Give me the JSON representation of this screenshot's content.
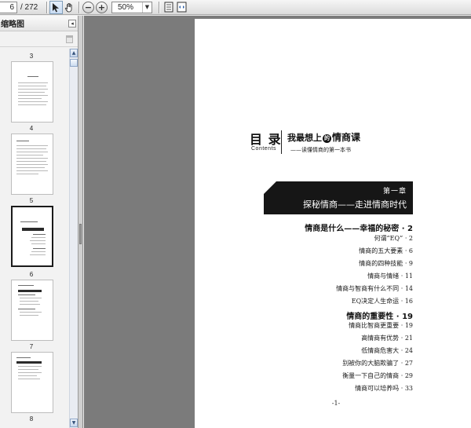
{
  "toolbar": {
    "page_current": "6",
    "page_total": "/ 272",
    "zoom": "50%",
    "icons": [
      "select-arrow-icon",
      "hand-icon",
      "zoom-out-icon",
      "zoom-in-icon",
      "fit-page-icon",
      "fit-width-icon"
    ]
  },
  "thumbnails": {
    "title": "缩略图",
    "labels": [
      "3",
      "4",
      "5",
      "6",
      "7",
      "8"
    ],
    "selected_page": "5"
  },
  "page": {
    "toc_label": "目 录",
    "contents_label": "Contents",
    "book_title_prefix": "我最想上",
    "book_title_mark": "的",
    "book_title_main": "情商课",
    "book_subtitle": "——读懂情商的第一本书",
    "chapter_no": "第一章",
    "chapter_title": "探秘情商——走进情商时代",
    "sections": [
      {
        "title": "情商是什么——幸福的秘密 · 2",
        "entries": [
          "何谓“EQ” · 2",
          "情商的五大要素 · 6",
          "情商的四种技能 · 9",
          "情商与情绪 · 11",
          "情商与智商有什么不同 · 14",
          "EQ决定人生命运 · 16"
        ]
      },
      {
        "title": "情商的重要性 · 19",
        "entries": [
          "情商比智商更重要 · 19",
          "高情商有优势 · 21",
          "低情商危害大 · 24",
          "别被你的大脑欺骗了 · 27",
          "衡量一下自己的情商 · 29",
          "情商可以培养吗 · 33"
        ]
      }
    ],
    "folio": "-1-"
  }
}
